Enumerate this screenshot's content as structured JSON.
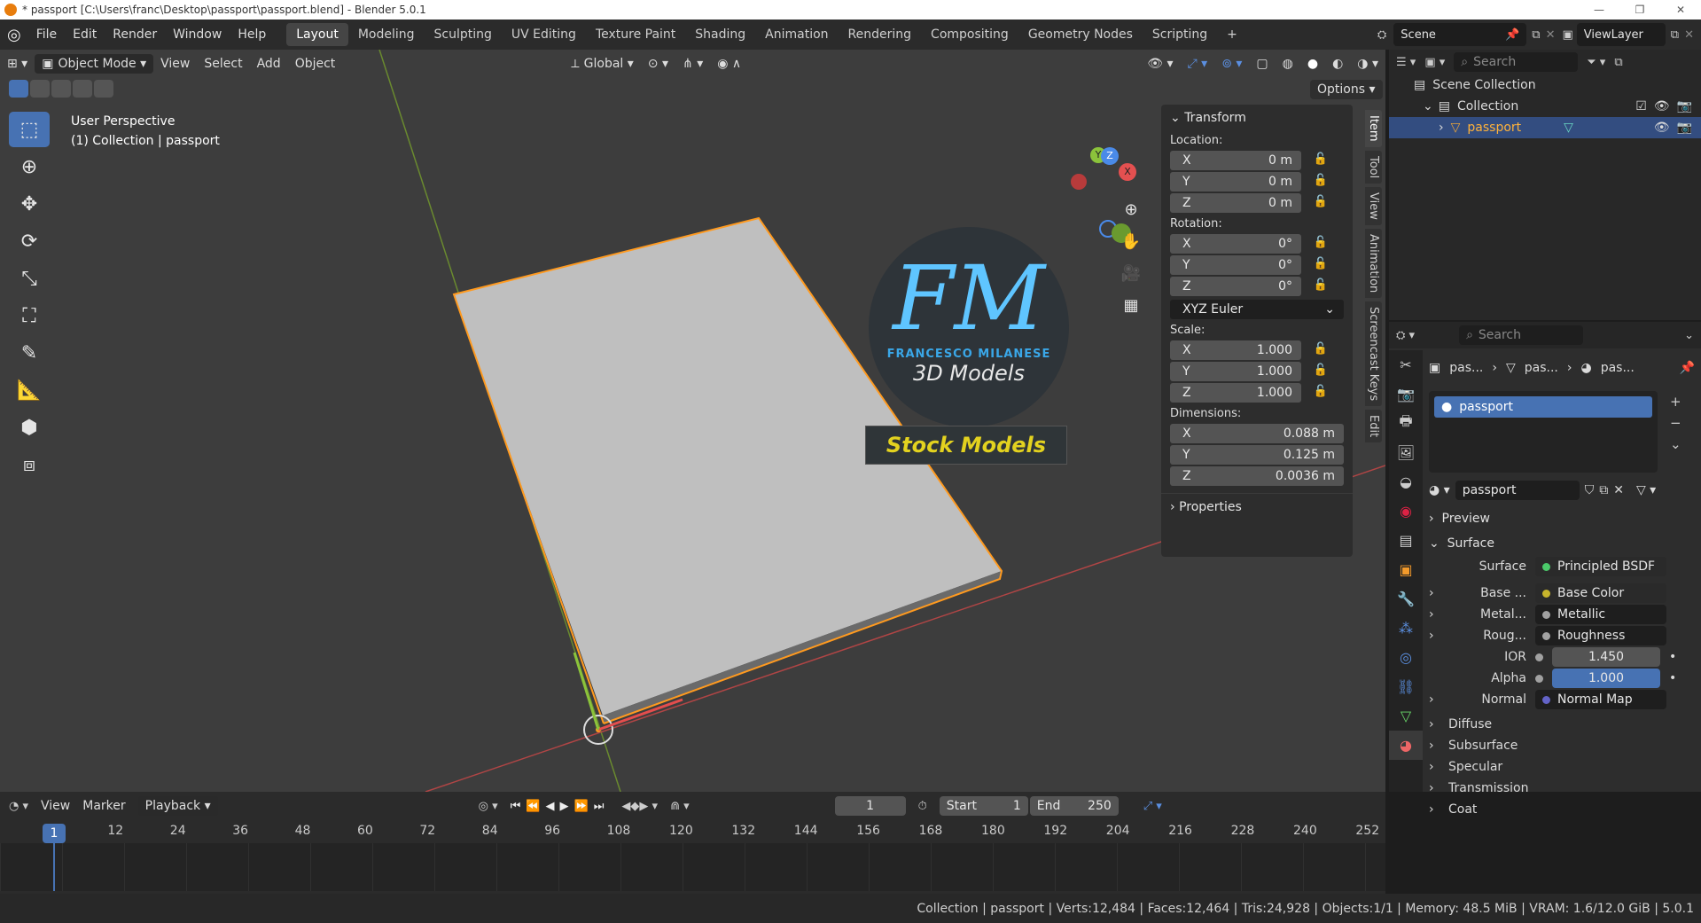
{
  "window": {
    "title": "* passport [C:\\Users\\franc\\Desktop\\passport\\passport.blend] - Blender 5.0.1",
    "controls": [
      "—",
      "❐",
      "✕"
    ]
  },
  "menu": [
    "File",
    "Edit",
    "Render",
    "Window",
    "Help"
  ],
  "workspaces": [
    "Layout",
    "Modeling",
    "Sculpting",
    "UV Editing",
    "Texture Paint",
    "Shading",
    "Animation",
    "Rendering",
    "Compositing",
    "Geometry Nodes",
    "Scripting"
  ],
  "scene": {
    "name": "Scene",
    "viewlayer": "ViewLayer"
  },
  "viewport": {
    "mode": "Object Mode",
    "menus": [
      "View",
      "Select",
      "Add",
      "Object"
    ],
    "transform_orientation": "Global",
    "options": "Options",
    "perspective": "User Perspective",
    "collection_info": "(1) Collection | passport"
  },
  "logo": {
    "text": "FM",
    "brand": "FRANCESCO MILANESE",
    "sub": "3D Models",
    "banner": "Stock Models"
  },
  "gizmo": {
    "x": "X",
    "y": "Y",
    "z": "Z"
  },
  "npanel": {
    "transform_title": "Transform",
    "location_label": "Location:",
    "location": [
      {
        "a": "X",
        "v": "0 m"
      },
      {
        "a": "Y",
        "v": "0 m"
      },
      {
        "a": "Z",
        "v": "0 m"
      }
    ],
    "rotation_label": "Rotation:",
    "rotation": [
      {
        "a": "X",
        "v": "0°"
      },
      {
        "a": "Y",
        "v": "0°"
      },
      {
        "a": "Z",
        "v": "0°"
      }
    ],
    "rotation_mode": "XYZ Euler",
    "scale_label": "Scale:",
    "scale": [
      {
        "a": "X",
        "v": "1.000"
      },
      {
        "a": "Y",
        "v": "1.000"
      },
      {
        "a": "Z",
        "v": "1.000"
      }
    ],
    "dimensions_label": "Dimensions:",
    "dimensions": [
      {
        "a": "X",
        "v": "0.088 m"
      },
      {
        "a": "Y",
        "v": "0.125 m"
      },
      {
        "a": "Z",
        "v": "0.0036 m"
      }
    ],
    "properties_title": "Properties",
    "tabs": [
      "Item",
      "Tool",
      "View",
      "Animation",
      "Screencast Keys",
      "Edit"
    ]
  },
  "outliner": {
    "search": "Search",
    "scene_collection": "Scene Collection",
    "collection": "Collection",
    "object": "passport"
  },
  "properties": {
    "search": "Search",
    "breadcrumb": [
      "pas...",
      "pas...",
      "pas..."
    ],
    "material_slot": "passport",
    "material_name": "passport",
    "preview": "Preview",
    "surface_section": "Surface",
    "surface_label": "Surface",
    "surface_value": "Principled BSDF",
    "inputs": [
      {
        "label": "Base ...",
        "value": "Base Color",
        "color": "#c7b42c"
      },
      {
        "label": "Metal...",
        "value": "Metallic",
        "color": "#a1a1a1"
      },
      {
        "label": "Roug...",
        "value": "Roughness",
        "color": "#a1a1a1"
      }
    ],
    "ior_label": "IOR",
    "ior": "1.450",
    "alpha_label": "Alpha",
    "alpha": "1.000",
    "normal_label": "Normal",
    "normal_value": "Normal Map",
    "subsections": [
      "Diffuse",
      "Subsurface",
      "Specular",
      "Transmission",
      "Coat"
    ]
  },
  "timeline": {
    "menus": [
      "View",
      "Marker",
      "Playback"
    ],
    "current_frame": "1",
    "start_label": "Start",
    "start": "1",
    "end_label": "End",
    "end": "250",
    "ticks": [
      "1",
      "12",
      "24",
      "36",
      "48",
      "60",
      "72",
      "84",
      "96",
      "108",
      "120",
      "132",
      "144",
      "156",
      "168",
      "180",
      "192",
      "204",
      "216",
      "228",
      "240",
      "252"
    ]
  },
  "status": {
    "text": "Collection | passport | Verts:12,484 | Faces:12,464 | Tris:24,928 | Objects:1/1 | Memory: 48.5 MiB | VRAM: 1.6/12.0 GiB | 5.0.1"
  },
  "colors": {
    "accent": "#4772b3",
    "selection": "#ff9a1f",
    "x_axis": "#e44d4d",
    "y_axis": "#8bc33b",
    "z_axis": "#4a8ae8"
  }
}
